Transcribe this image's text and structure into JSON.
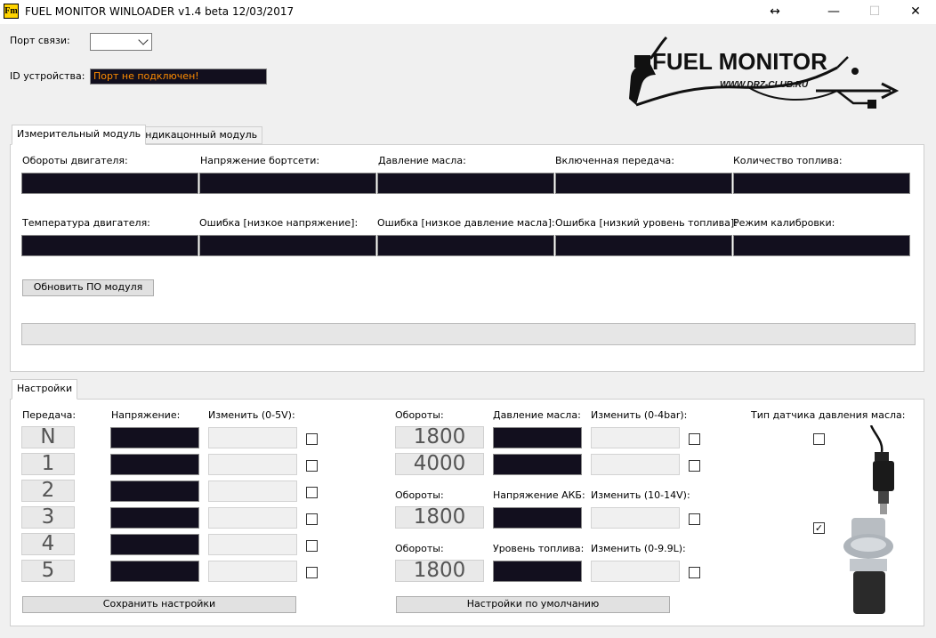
{
  "window": {
    "title": "FUEL MONITOR WINLOADER v1.4 beta 12/03/2017",
    "icon_text": "Fm",
    "controls": {
      "resize": "↔",
      "minimize": "—",
      "maximize": "☐",
      "close": "✕"
    }
  },
  "connection": {
    "port_label": "Порт связи:",
    "port_value": "",
    "device_id_label": "ID устройства:",
    "device_id_value": "Порт  не подключен!"
  },
  "logo": {
    "text": "FUEL MONITOR",
    "url_text": "WWW.DRZ-CLUB.RU"
  },
  "tabs": [
    {
      "label": "Измерительный модуль",
      "active": true
    },
    {
      "label": "Индикацонный модуль",
      "active": false
    }
  ],
  "measure": {
    "row1": [
      "Обороты двигателя:",
      "Напряжение бортсети:",
      "Давление масла:",
      "Включенная передача:",
      "Количество топлива:"
    ],
    "row2": [
      "Температура двигателя:",
      "Ошибка [низкое напряжение]:",
      "Ошибка [низкое давление масла]:",
      "Ошибка [низкий уровень топлива]:",
      "Режим калибровки:"
    ],
    "update_button": "Обновить ПО модуля",
    "progress": 0
  },
  "settings": {
    "tab_label": "Настройки",
    "gear_col": {
      "gear_label": "Передача:",
      "voltage_label": "Напряжение:",
      "change_label": "Изменить (0-5V):",
      "gears": [
        "N",
        "1",
        "2",
        "3",
        "4",
        "5"
      ]
    },
    "rpm_label": "Обороты:",
    "oil": {
      "label": "Давление масла:",
      "change_label": "Изменить (0-4bar):",
      "rpms": [
        "1800",
        "4000"
      ]
    },
    "battery": {
      "label": "Напряжение АКБ:",
      "change_label": "Изменить (10-14V):",
      "rpm": "1800"
    },
    "fuel": {
      "label": "Уровень топлива:",
      "change_label": "Изменить (0-9.9L):",
      "rpm": "1800"
    },
    "sensor_type_label": "Тип датчика давления масла:",
    "sensor_type_checks": [
      false,
      true
    ],
    "save_button": "Сохранить настройки",
    "default_button": "Настройки по умолчанию"
  },
  "colors": {
    "dark_field": "#120f1e",
    "status_text": "#ff8c00"
  }
}
